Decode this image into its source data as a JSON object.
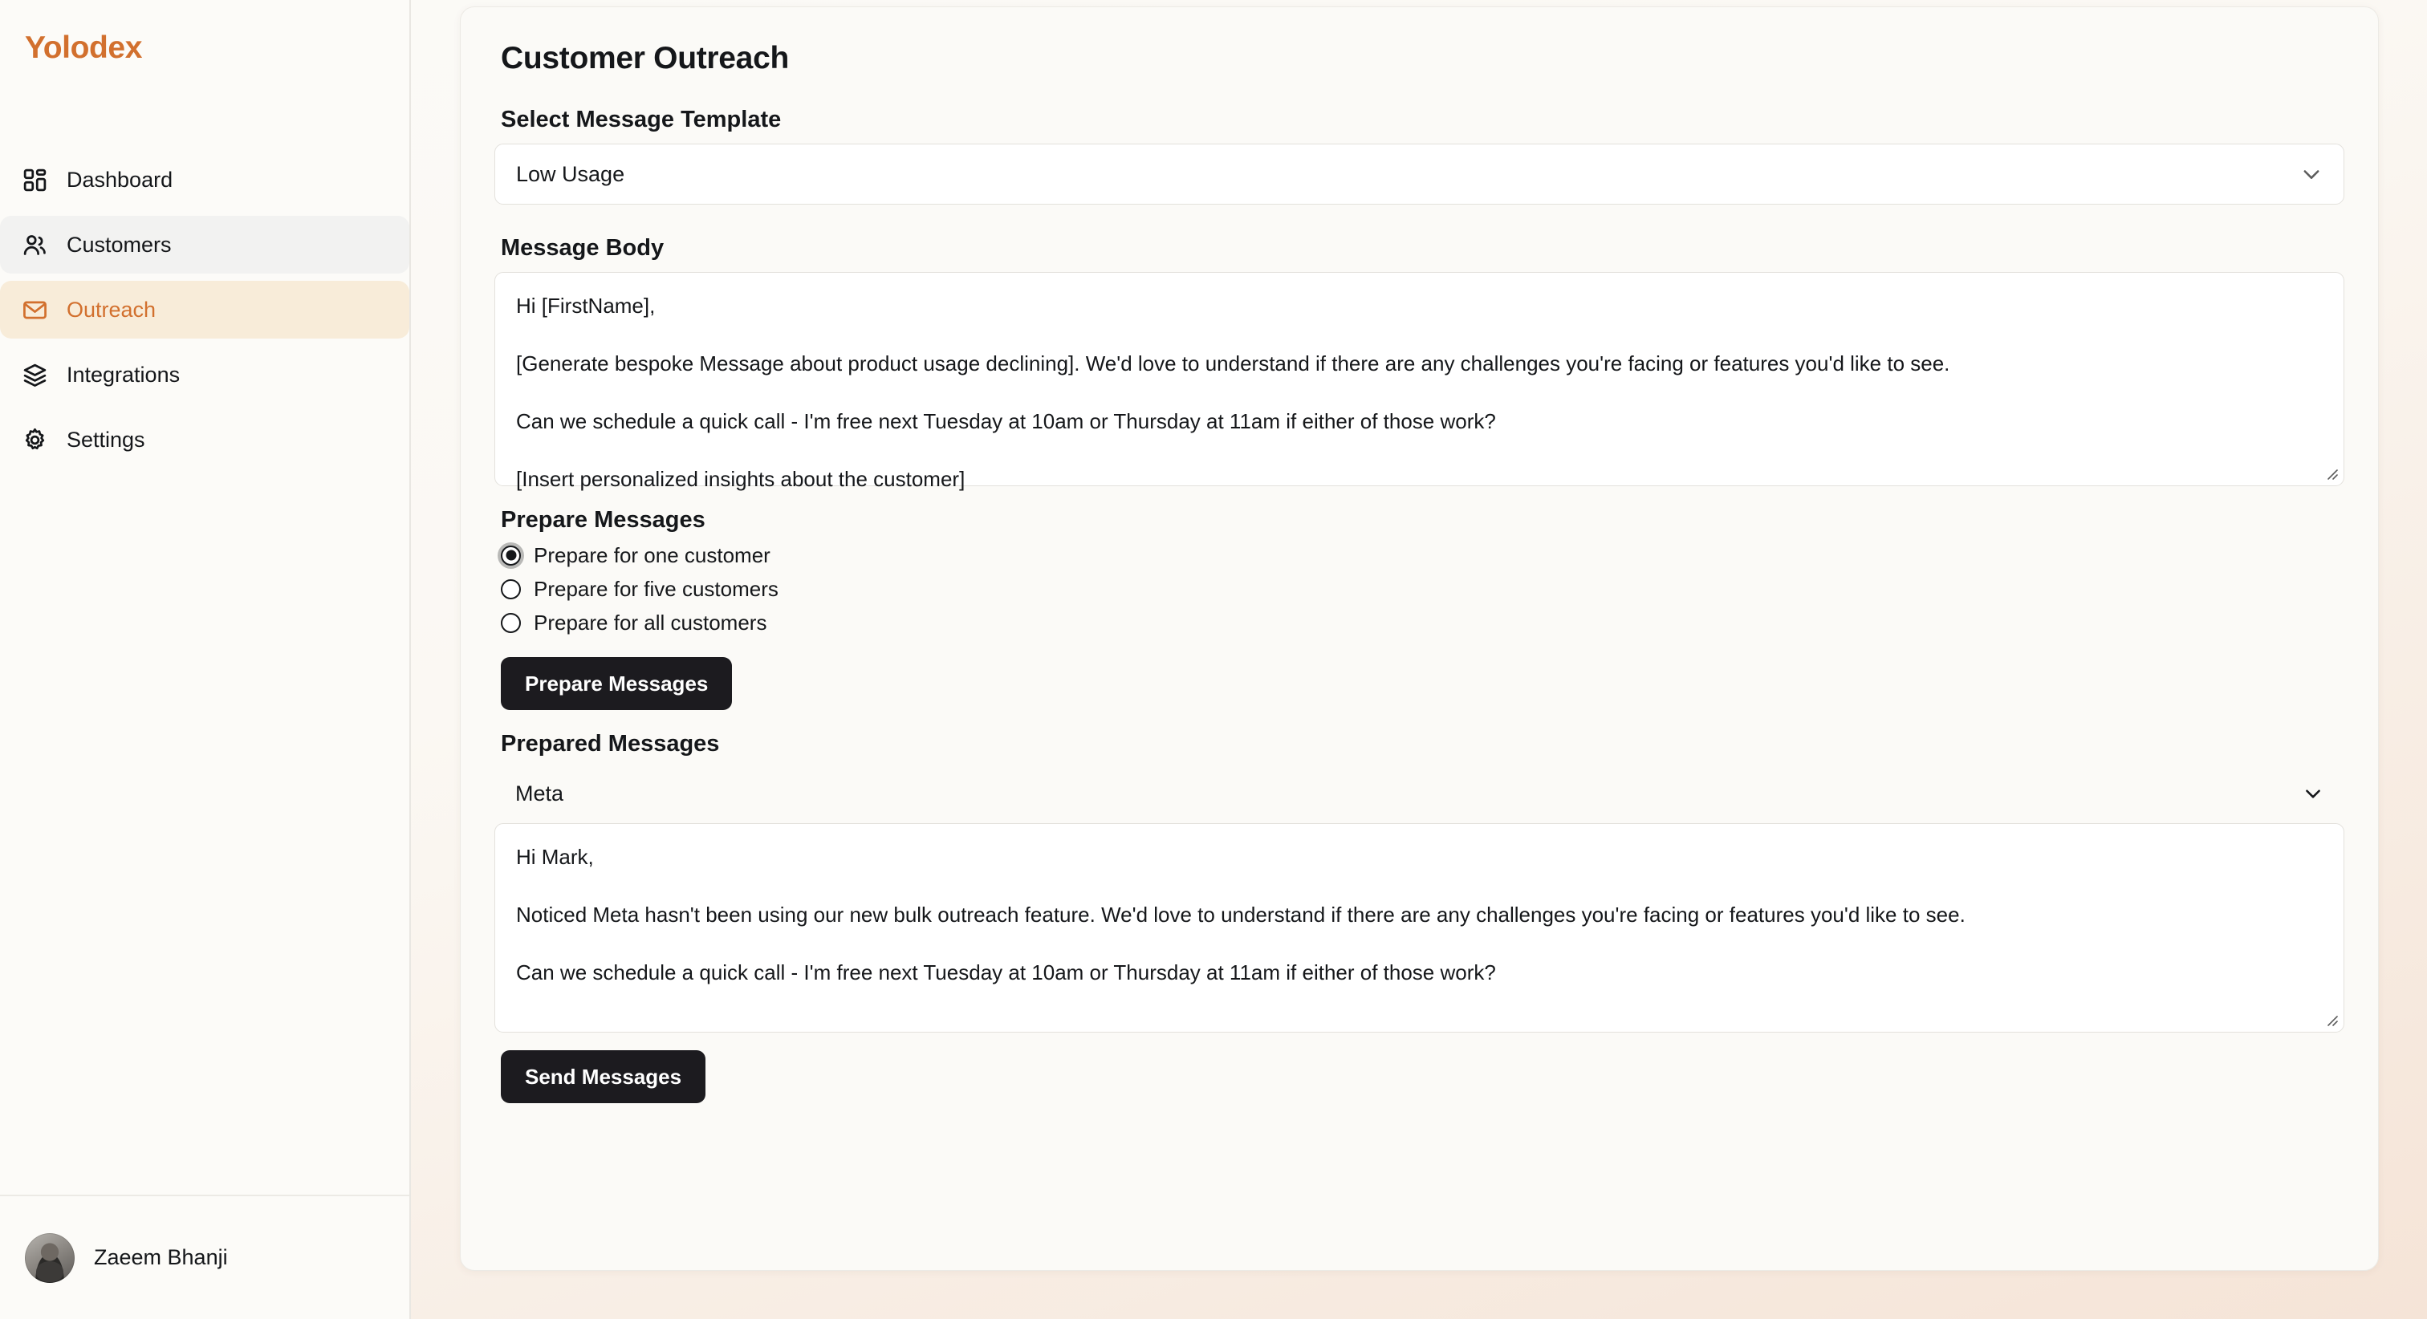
{
  "brand": {
    "name": "Yolodex"
  },
  "sidebar": {
    "items": [
      {
        "label": "Dashboard",
        "icon": "grid-icon",
        "state": "default"
      },
      {
        "label": "Customers",
        "icon": "users-icon",
        "state": "hover"
      },
      {
        "label": "Outreach",
        "icon": "envelope-icon",
        "state": "active"
      },
      {
        "label": "Integrations",
        "icon": "layers-icon",
        "state": "default"
      },
      {
        "label": "Settings",
        "icon": "gear-icon",
        "state": "default"
      }
    ],
    "user": {
      "name": "Zaeem Bhanji",
      "avatar": "user-avatar"
    }
  },
  "main": {
    "title": "Customer Outreach",
    "template": {
      "label": "Select Message Template",
      "selected": "Low Usage",
      "chevron": "chevron-down-icon"
    },
    "message_body": {
      "label": "Message Body",
      "lines": [
        "Hi [FirstName],",
        "[Generate bespoke Message about product usage declining]. We'd love to understand if there are any challenges you're facing or features you'd like to see.",
        "Can we schedule a quick call - I'm free next Tuesday at 10am or Thursday at 11am if either of those work?",
        "[Insert personalized insights about the customer]"
      ]
    },
    "prepare": {
      "title": "Prepare Messages",
      "options": [
        {
          "label": "Prepare for one customer",
          "selected": true
        },
        {
          "label": "Prepare for five customers",
          "selected": false
        },
        {
          "label": "Prepare for all customers",
          "selected": false
        }
      ],
      "button_label": "Prepare Messages"
    },
    "prepared": {
      "title": "Prepared Messages",
      "accordion": {
        "label": "Meta",
        "chevron": "chevron-down-icon"
      },
      "lines": [
        "Hi Mark,",
        "Noticed Meta hasn't been using our new bulk outreach feature. We'd love to understand if there are any challenges you're facing or features you'd like to see.",
        "Can we schedule a quick call - I'm free next Tuesday at 10am or Thursday at 11am if either of those work?"
      ],
      "send_button_label": "Send Messages"
    }
  },
  "colors": {
    "brand_orange": "#d2702e",
    "active_nav_bg": "#f8ecd9",
    "hover_nav_bg": "#f2f2f1",
    "card_bg": "#fbfaf7",
    "button_dark": "#1c1b1f",
    "page_bg_accent": "#f5e4d7"
  }
}
